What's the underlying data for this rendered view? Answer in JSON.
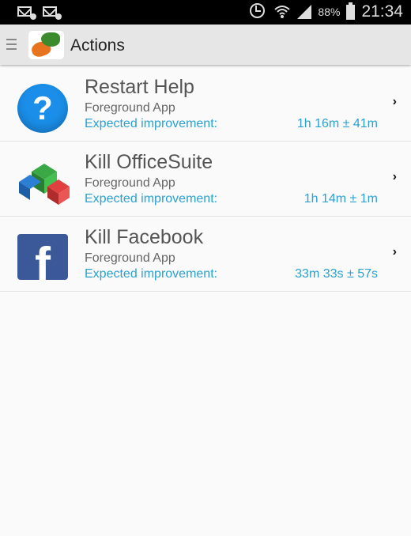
{
  "status_bar": {
    "battery_percent": "88%",
    "time": "21:34"
  },
  "action_bar": {
    "title": "Actions"
  },
  "actions": [
    {
      "title": "Restart Help",
      "subtitle": "Foreground App",
      "improvement_label": "Expected improvement:",
      "improvement_value": "1h 16m ± 41m",
      "icon": "help-question-icon"
    },
    {
      "title": "Kill OfficeSuite",
      "subtitle": "Foreground App",
      "improvement_label": "Expected improvement:",
      "improvement_value": "1h 14m ± 1m",
      "icon": "officesuite-icon"
    },
    {
      "title": "Kill Facebook",
      "subtitle": "Foreground App",
      "improvement_label": "Expected improvement:",
      "improvement_value": "33m 33s ± 57s",
      "icon": "facebook-icon"
    }
  ],
  "colors": {
    "accent": "#2aa1d2",
    "action_bar_bg": "#e6e6e6",
    "status_bar_bg": "#000000"
  }
}
